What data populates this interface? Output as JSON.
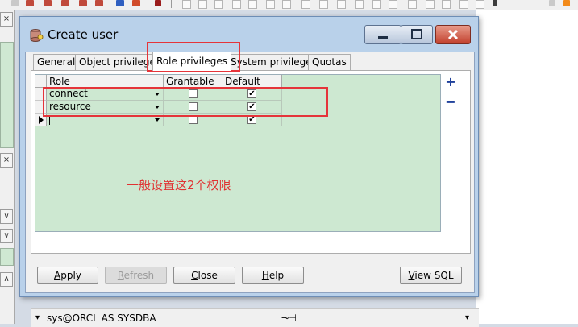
{
  "dialog": {
    "title": "Create user",
    "tabs": [
      {
        "label": "General"
      },
      {
        "label": "Object privileges"
      },
      {
        "label": "Role privileges"
      },
      {
        "label": "System privileges"
      },
      {
        "label": "Quotas"
      }
    ],
    "active_tab": "Role privileges",
    "grid": {
      "columns": [
        "Role",
        "Grantable",
        "Default"
      ],
      "rows": [
        {
          "role": "connect",
          "grantable": false,
          "default": true
        },
        {
          "role": "resource",
          "grantable": false,
          "default": true
        },
        {
          "role": "",
          "grantable": false,
          "default": true
        }
      ]
    },
    "side_buttons": {
      "add": "+",
      "remove": "−"
    },
    "annotation": "一般设置这2个权限",
    "buttons": {
      "apply": {
        "first": "A",
        "rest": "pply"
      },
      "refresh": {
        "first": "R",
        "rest": "efresh"
      },
      "close": {
        "first": "C",
        "rest": "lose"
      },
      "help": {
        "first": "H",
        "rest": "elp"
      },
      "view_sql": {
        "first": "V",
        "rest": "iew SQL"
      }
    },
    "status": {
      "connection": "sys@ORCL AS SYSDBA",
      "left_arrow": "▾",
      "right_arrow": "▾",
      "pin": "⊸⊣"
    }
  },
  "background": {
    "close_glyphs": [
      "×",
      "×"
    ],
    "scroll_glyphs": [
      "∨",
      "∨",
      "∧"
    ]
  },
  "colors": {
    "grid_bg": "#cde8d1",
    "annotation": "#e03232",
    "highlight_box": "#e5343a"
  }
}
